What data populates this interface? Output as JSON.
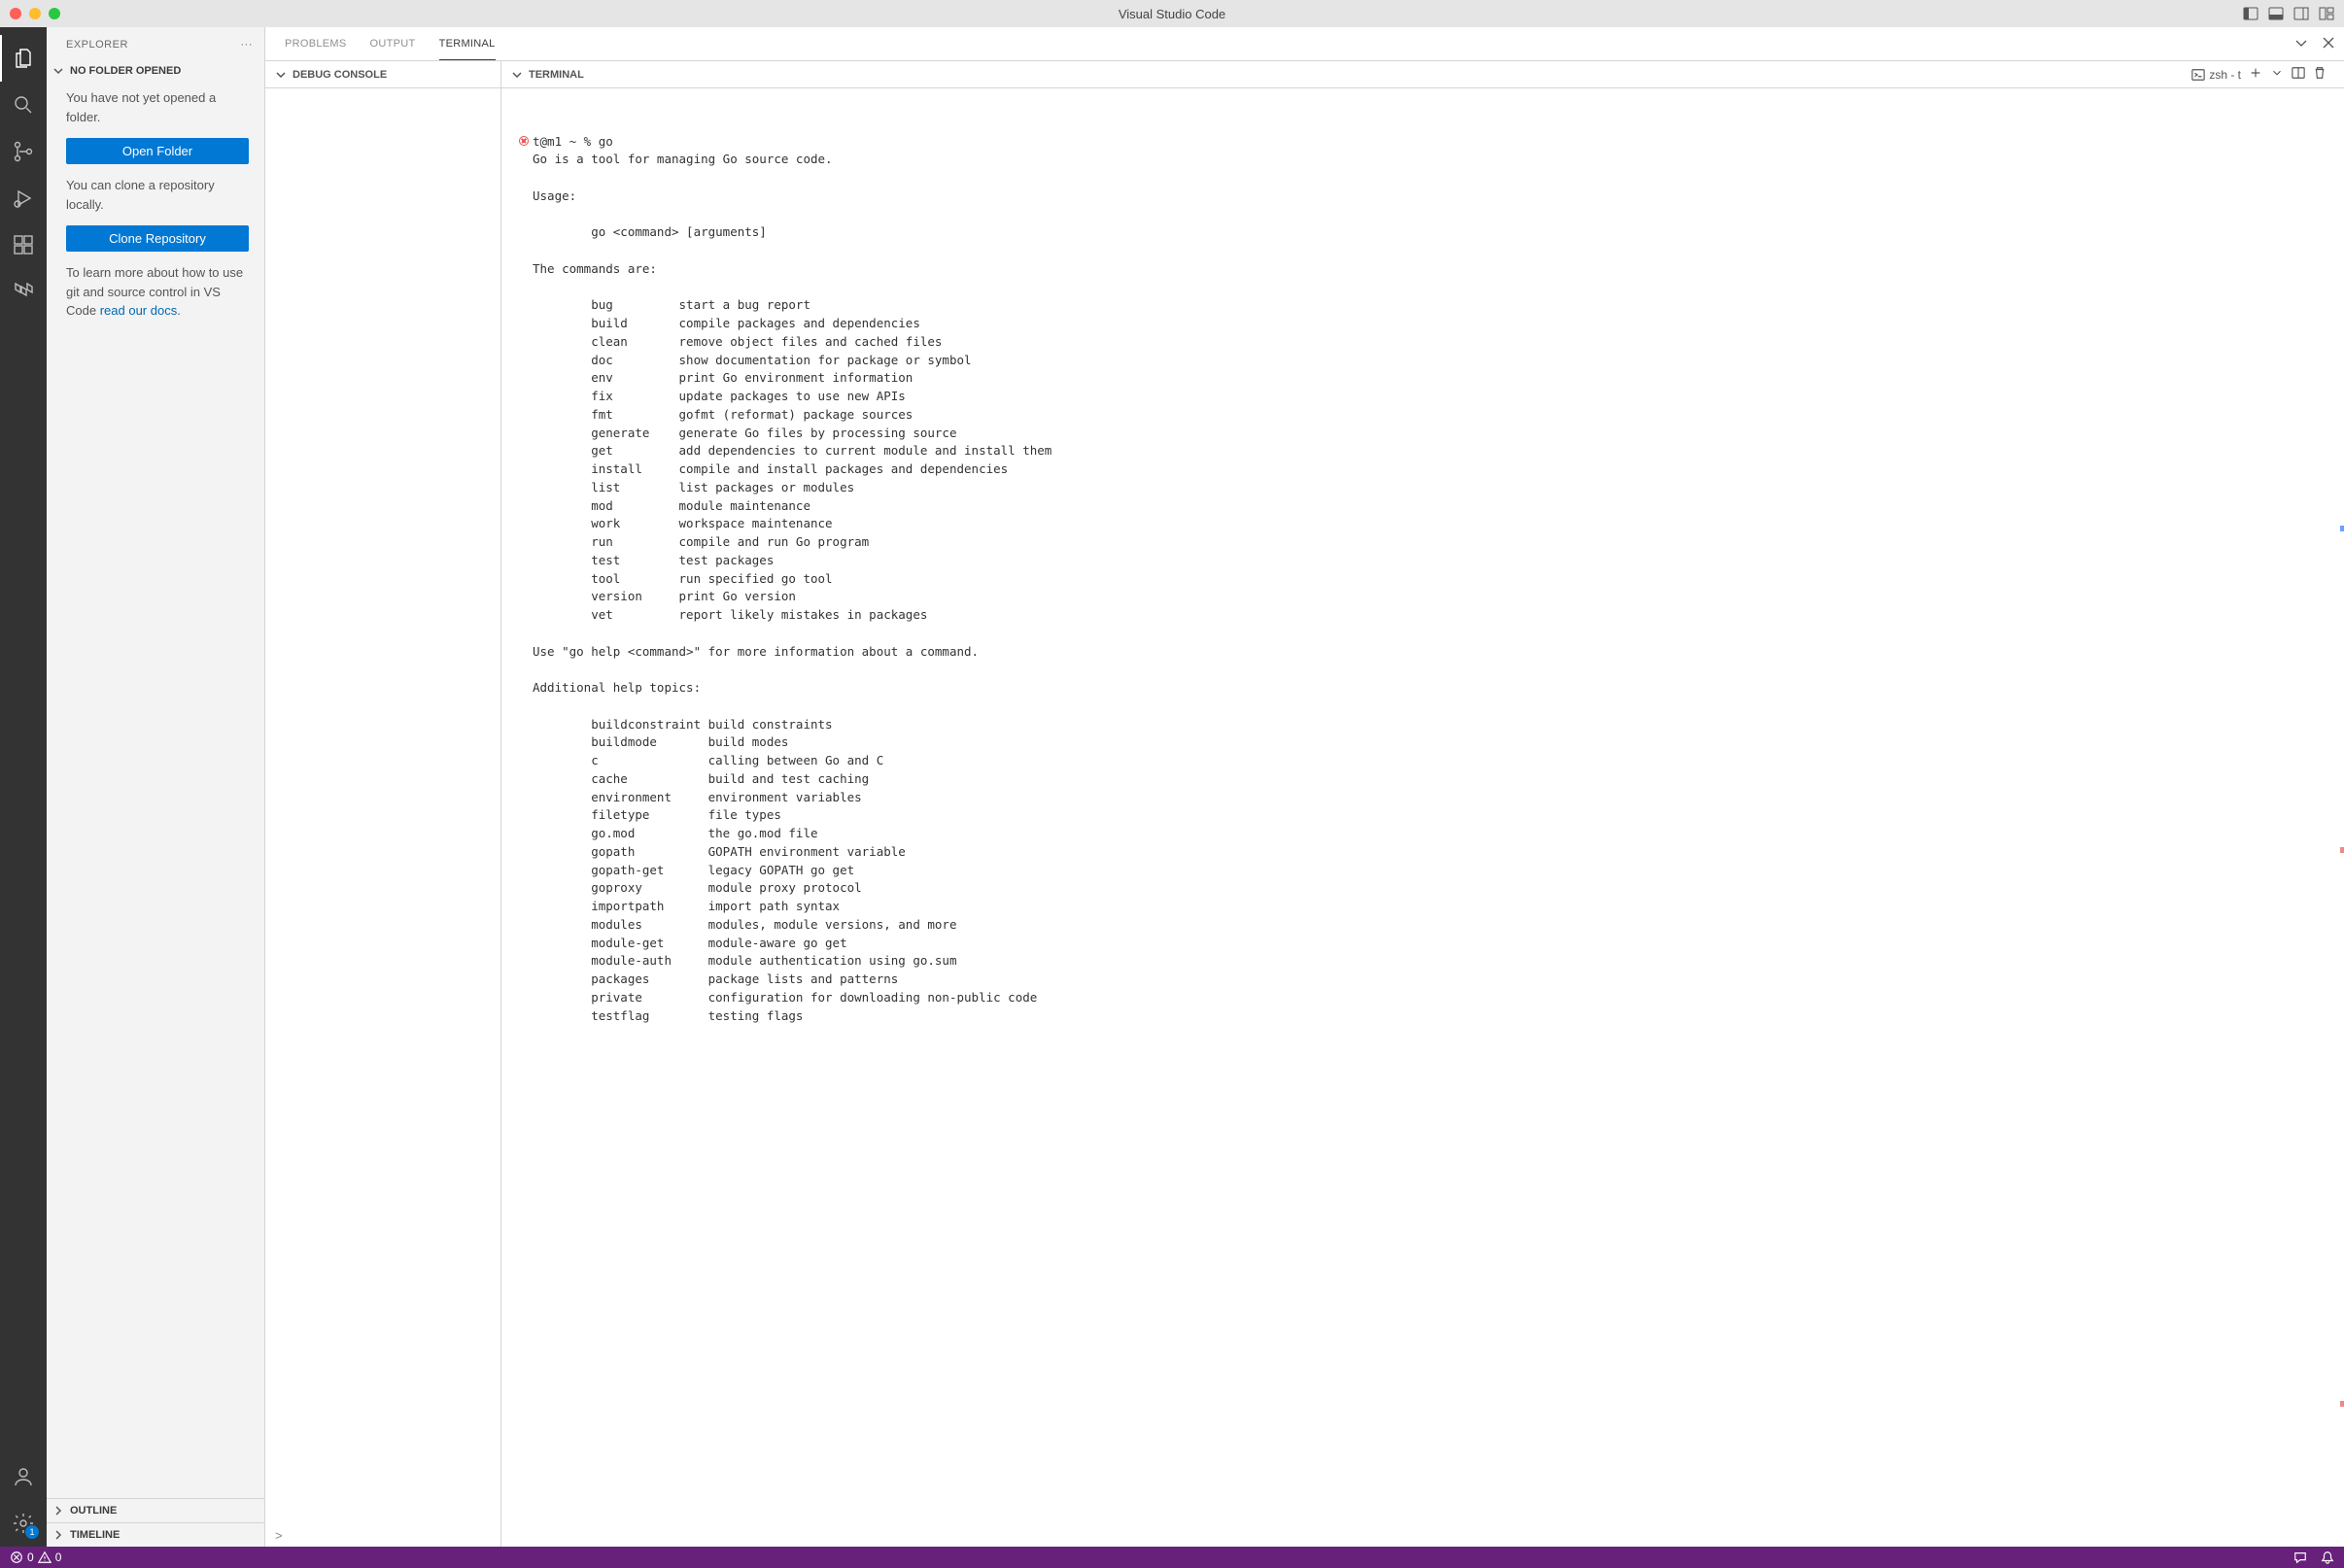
{
  "window": {
    "title": "Visual Studio Code"
  },
  "sidebar": {
    "title": "EXPLORER",
    "no_folder_header": "NO FOLDER OPENED",
    "msg_not_opened": "You have not yet opened a folder.",
    "open_folder_label": "Open Folder",
    "msg_clone": "You can clone a repository locally.",
    "clone_repo_label": "Clone Repository",
    "msg_learn_prefix": "To learn more about how to use git and source control in VS Code ",
    "msg_learn_link": "read our docs",
    "msg_learn_suffix": ".",
    "outline": "OUTLINE",
    "timeline": "TIMELINE"
  },
  "activity_badge": "1",
  "panel": {
    "tabs": {
      "problems": "PROBLEMS",
      "output": "OUTPUT",
      "terminal": "TERMINAL"
    },
    "sub": {
      "debug_console": "DEBUG CONSOLE",
      "terminal": "TERMINAL"
    },
    "shell_label": "zsh - t",
    "debug_prompt": ">"
  },
  "terminal": {
    "prompt": "t@m1 ~ % go",
    "body": "Go is a tool for managing Go source code.\n\nUsage:\n\n        go <command> [arguments]\n\nThe commands are:\n\n        bug         start a bug report\n        build       compile packages and dependencies\n        clean       remove object files and cached files\n        doc         show documentation for package or symbol\n        env         print Go environment information\n        fix         update packages to use new APIs\n        fmt         gofmt (reformat) package sources\n        generate    generate Go files by processing source\n        get         add dependencies to current module and install them\n        install     compile and install packages and dependencies\n        list        list packages or modules\n        mod         module maintenance\n        work        workspace maintenance\n        run         compile and run Go program\n        test        test packages\n        tool        run specified go tool\n        version     print Go version\n        vet         report likely mistakes in packages\n\nUse \"go help <command>\" for more information about a command.\n\nAdditional help topics:\n\n        buildconstraint build constraints\n        buildmode       build modes\n        c               calling between Go and C\n        cache           build and test caching\n        environment     environment variables\n        filetype        file types\n        go.mod          the go.mod file\n        gopath          GOPATH environment variable\n        gopath-get      legacy GOPATH go get\n        goproxy         module proxy protocol\n        importpath      import path syntax\n        modules         modules, module versions, and more\n        module-get      module-aware go get\n        module-auth     module authentication using go.sum\n        packages        package lists and patterns\n        private         configuration for downloading non-public code\n        testflag        testing flags"
  },
  "statusbar": {
    "errors": "0",
    "warnings": "0"
  }
}
